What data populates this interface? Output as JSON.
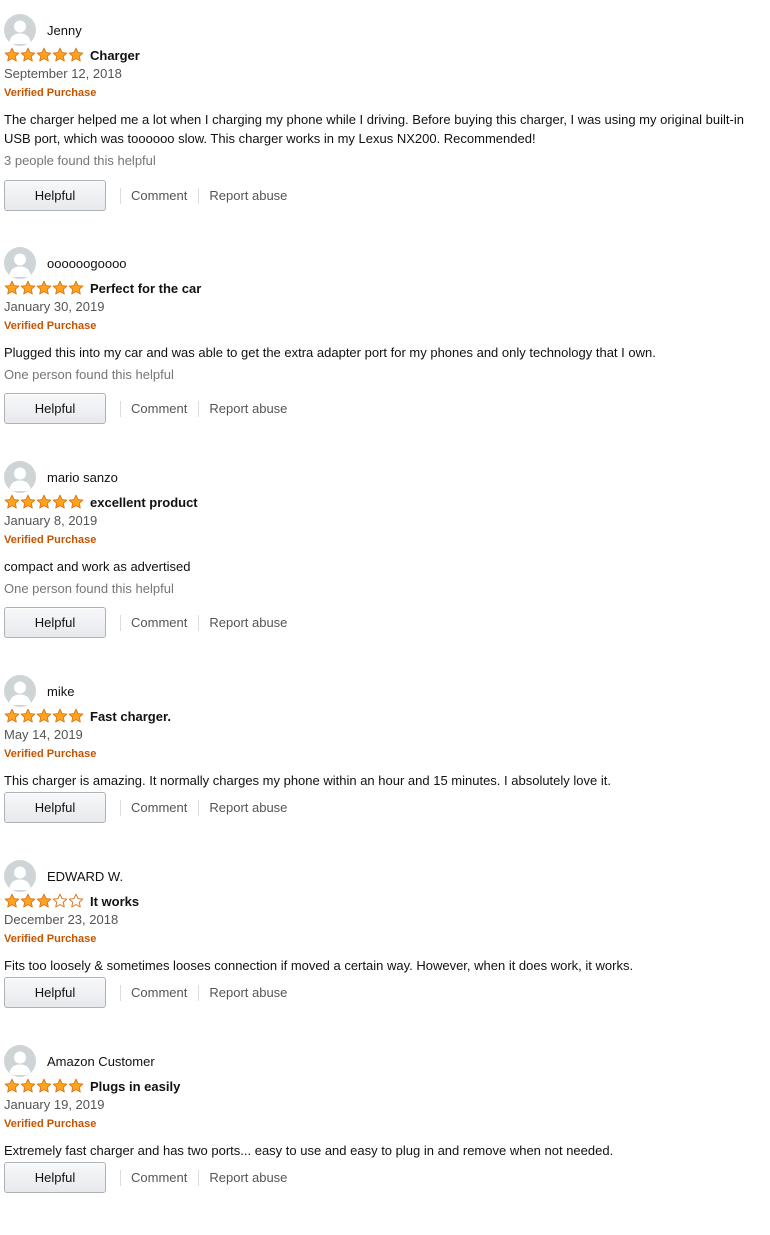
{
  "colors": {
    "star_fill": "#ffa41c",
    "star_stroke": "#de7921",
    "verified": "#c45500",
    "avatar_bg": "#cfd4d6"
  },
  "labels": {
    "verified": "Verified Purchase",
    "helpful_button": "Helpful",
    "comment_link": "Comment",
    "report_link": "Report abuse"
  },
  "icons": {
    "avatar": "user-silhouette-icon",
    "star_full": "star-filled-icon",
    "star_empty": "star-empty-icon"
  },
  "reviews": [
    {
      "reviewer": "Jenny",
      "rating": 5,
      "title": "Charger",
      "date": "September 12, 2018",
      "body": "The charger helped me a lot when I charging my phone while I driving. Before buying this charger, I was using my original built-in USB port, which was toooooo slow. This charger works in my Lexus NX200. Recommended!",
      "helpful_text": "3 people found this helpful"
    },
    {
      "reviewer": "oooooogoooo",
      "rating": 5,
      "title": "Perfect for the car",
      "date": "January 30, 2019",
      "body": "Plugged this into my car and was able to get the extra adapter port for my phones and only technology that I own.",
      "helpful_text": "One person found this helpful"
    },
    {
      "reviewer": "mario sanzo",
      "rating": 5,
      "title": "excellent product",
      "date": "January 8, 2019",
      "body": "compact and work as advertised",
      "helpful_text": "One person found this helpful"
    },
    {
      "reviewer": "mike",
      "rating": 5,
      "title": "Fast charger.",
      "date": "May 14, 2019",
      "body": "This charger is amazing. It normally charges my phone within an hour and 15 minutes. I absolutely love it.",
      "helpful_text": ""
    },
    {
      "reviewer": "EDWARD W.",
      "rating": 3,
      "title": "It works",
      "date": "December 23, 2018",
      "body": "Fits too loosely & sometimes looses connection if moved a certain way. However, when it does work, it works.",
      "helpful_text": ""
    },
    {
      "reviewer": "Amazon Customer",
      "rating": 5,
      "title": "Plugs in easily",
      "date": "January 19, 2019",
      "body": "Extremely fast charger and has two ports... easy to use and easy to plug in and remove when not needed.",
      "helpful_text": ""
    }
  ]
}
